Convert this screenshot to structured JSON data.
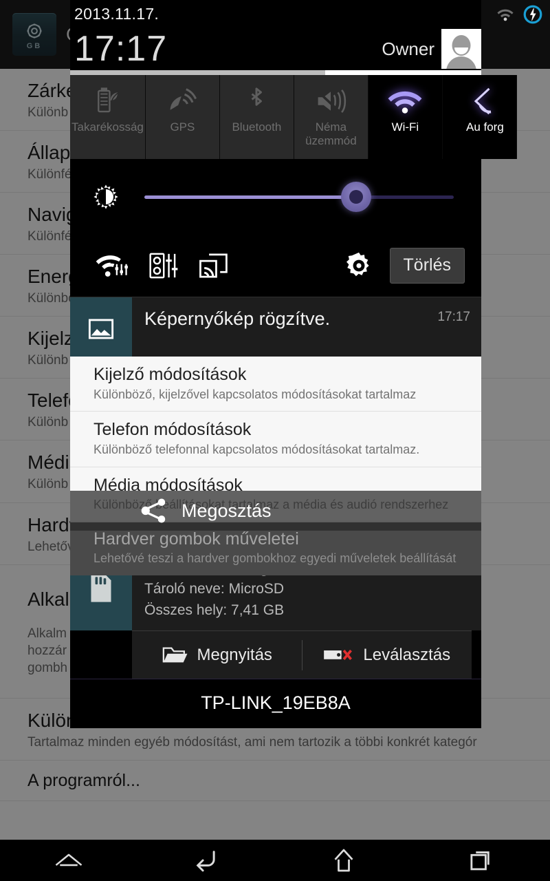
{
  "statusbar": {
    "date": "2013.11.17.",
    "wifi_icon": "wifi-icon",
    "battery_icon": "battery-charging-icon"
  },
  "background_app": {
    "app_icon": "gearbox-app-icon",
    "app_icon_label": "GB",
    "title": "G",
    "list": [
      {
        "title": "Zárké",
        "subtitle": "Különb"
      },
      {
        "title": "Állapo",
        "subtitle": "Különfé"
      },
      {
        "title": "Navig",
        "subtitle": "Különfé"
      },
      {
        "title": "Energ",
        "subtitle": "Különböző energiafel"
      },
      {
        "title": "Kijelző",
        "subtitle": "Különb"
      },
      {
        "title": "Telefon",
        "subtitle": "Különb"
      },
      {
        "title": "Média",
        "subtitle": "Különb"
      },
      {
        "title": "Hardv",
        "subtitle": "Lehetővé teszi a hardver gomboknak egyedi műveletek beállítását"
      },
      {
        "title": "Alkalm",
        "subtitle": "Alkalm\nhozzár\ngombh"
      },
      {
        "title": "Külön",
        "subtitle": "Tartalmaz minden egyéb módosítást, ami nem tartozik a többi konkrét kategór"
      }
    ],
    "about": "A programról..."
  },
  "shade": {
    "clock": "17:17",
    "owner": "Owner",
    "avatar": "user-avatar",
    "scroll_fill_percent": 62,
    "toggles": [
      {
        "id": "power-saving",
        "label": "Takarékosság",
        "icon": "battery-leaf-icon",
        "active": false
      },
      {
        "id": "gps",
        "label": "GPS",
        "icon": "gps-icon",
        "active": false
      },
      {
        "id": "bluetooth",
        "label": "Bluetooth",
        "icon": "bluetooth-icon",
        "active": false
      },
      {
        "id": "silent-mode",
        "label": "Néma üzemmód",
        "icon": "mute-icon",
        "active": false
      },
      {
        "id": "wifi",
        "label": "Wi-Fi",
        "icon": "wifi-icon",
        "active": true
      },
      {
        "id": "auto-rotate",
        "label": "Au forg",
        "icon": "auto-rotate-icon",
        "active": true
      }
    ],
    "brightness": {
      "icon": "brightness-icon",
      "value_percent": 64
    },
    "quick_actions": [
      {
        "id": "wifi-settings",
        "icon": "wifi-settings-icon"
      },
      {
        "id": "sound-settings",
        "icon": "equalizer-icon"
      },
      {
        "id": "screen-mirroring",
        "icon": "cast-icon"
      },
      {
        "id": "settings",
        "icon": "gear-icon"
      }
    ],
    "clear_label": "Törlés"
  },
  "notifications": [
    {
      "id": "screenshot",
      "icon": "image-icon",
      "title": "Képernyőkép rögzítve.",
      "time": "17:17",
      "lines": []
    },
    {
      "id": "external-storage",
      "icon": "sdcard-icon",
      "title": "External storage inserted",
      "time": "",
      "lines": [
        "Tároló neve: MicroSD",
        "Összes hely: 7,41 GB"
      ],
      "actions": [
        {
          "id": "open",
          "label": "Megnyitás",
          "icon": "folder-icon"
        },
        {
          "id": "unmount",
          "label": "Leválasztás",
          "icon": "eject-icon"
        }
      ]
    }
  ],
  "toast": {
    "text": "TP-LINK_19EB8A"
  },
  "share_sheet": {
    "bar_label": "Megosztás",
    "bar_icon": "share-icon",
    "items": [
      {
        "title": "Kijelző módosítások",
        "subtitle": "Különböző, kijelzővel kapcsolatos módosításokat tartalmaz"
      },
      {
        "title": "Telefon módosítások",
        "subtitle": "Különböző telefonnal kapcsolatos módosításokat tartalmaz."
      },
      {
        "title": "Média módosítások",
        "subtitle": "Különböző beállításokat tartalmaz a média és audió rendszerhez"
      }
    ],
    "dimmed_item": {
      "title": "Hardver gombok műveletei",
      "subtitle": "Lehetővé teszi a hardver gombokhoz egyedi műveletek beállítását"
    }
  },
  "navbar": [
    {
      "id": "collapse",
      "icon": "chevron-up-icon"
    },
    {
      "id": "back",
      "icon": "back-icon"
    },
    {
      "id": "home",
      "icon": "home-icon"
    },
    {
      "id": "recents",
      "icon": "recents-icon"
    }
  ],
  "colors": {
    "accent": "#9b8fd4",
    "notif_icon_bg": "#25464f",
    "shade_bg": "#000000"
  }
}
